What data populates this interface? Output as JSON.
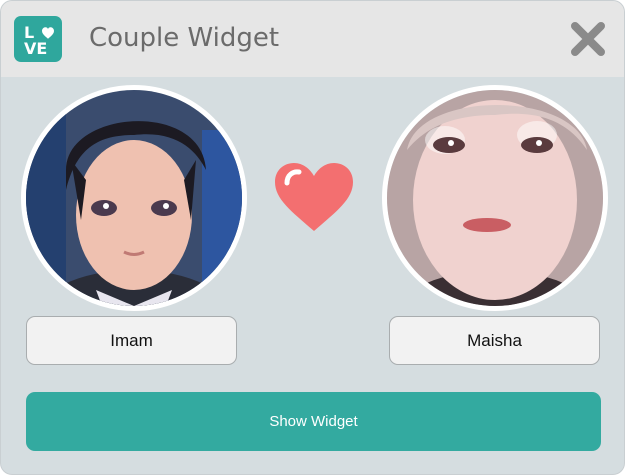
{
  "window": {
    "title": "Couple Widget",
    "logo": {
      "icon": "love-logo-icon",
      "text": "LOVE",
      "color": "#2fa79d"
    },
    "close_icon": "close-icon"
  },
  "left_person": {
    "name": "Imam",
    "avatar": "avatar-imam"
  },
  "right_person": {
    "name": "Maisha",
    "avatar": "avatar-maisha"
  },
  "heart": {
    "icon": "heart-icon",
    "color": "#f36f70"
  },
  "actions": {
    "show_widget_label": "Show Widget",
    "button_color": "#33aaa0"
  }
}
